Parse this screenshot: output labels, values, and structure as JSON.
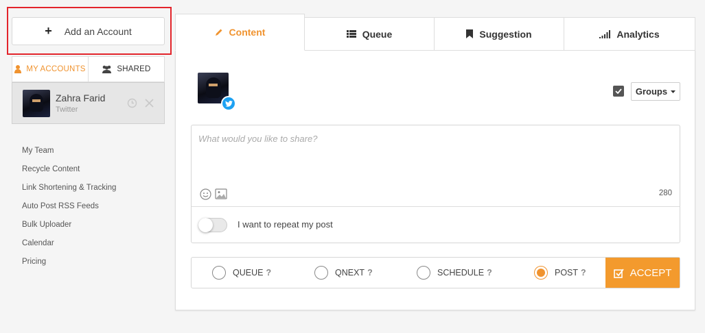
{
  "left": {
    "add_account_label": "Add an Account",
    "tabs": {
      "my_accounts": "MY ACCOUNTS",
      "shared": "SHARED"
    },
    "account": {
      "name": "Zahra Farid",
      "network": "Twitter"
    },
    "nav": [
      "My Team",
      "Recycle Content",
      "Link Shortening & Tracking",
      "Auto Post RSS Feeds",
      "Bulk Uploader",
      "Calendar",
      "Pricing"
    ]
  },
  "tabs": {
    "content": "Content",
    "queue": "Queue",
    "suggestion": "Suggestion",
    "analytics": "Analytics"
  },
  "groups_label": "Groups",
  "compose": {
    "placeholder": "What would you like to share?",
    "char_count": "280",
    "repeat_label": "I want to repeat my post"
  },
  "post_options": {
    "queue": "QUEUE",
    "qnext": "QNEXT",
    "schedule": "SCHEDULE",
    "post": "POST",
    "help_mark": "?",
    "accept": "ACCEPT",
    "selected": "post"
  },
  "colors": {
    "accent": "#f0932f",
    "twitter": "#1da1f2",
    "highlight": "#e3242b"
  }
}
